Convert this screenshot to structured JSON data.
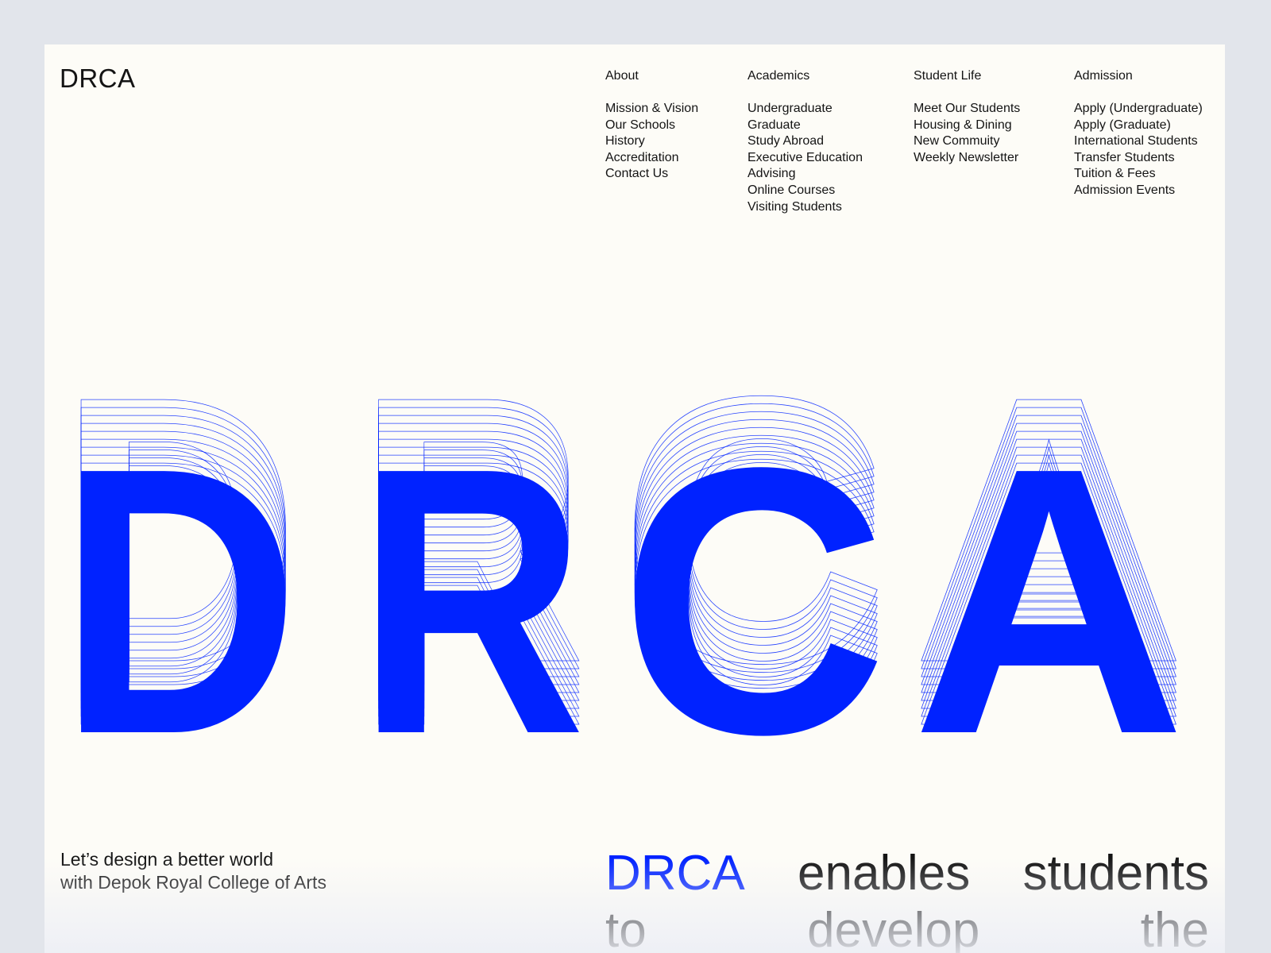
{
  "logo": "DRCA",
  "nav": [
    {
      "heading": "About",
      "items": [
        "Mission & Vision",
        "Our Schools",
        "History",
        "Accreditation",
        "Contact Us"
      ]
    },
    {
      "heading": "Academics",
      "items": [
        "Undergraduate",
        "Graduate",
        "Study Abroad",
        "Executive Education",
        "Advising",
        "Online Courses",
        "Visiting Students"
      ]
    },
    {
      "heading": "Student Life",
      "items": [
        "Meet Our Students",
        "Housing & Dining",
        "New Commuity",
        "Weekly Newsletter"
      ]
    },
    {
      "heading": "Admission",
      "items": [
        "Apply (Undergraduate)",
        "Apply (Graduate)",
        "International Students",
        "Transfer Students",
        "Tuition & Fees",
        "Admission Events"
      ]
    }
  ],
  "hero": {
    "letters": [
      "D",
      "R",
      "C",
      "A"
    ],
    "accent_color": "#0022ff"
  },
  "tagline": {
    "line1": "Let’s design a better world",
    "line2": "with Depok Royal College of Arts"
  },
  "statement": {
    "line1": [
      "DRCA",
      "enables",
      "students"
    ],
    "line2": [
      "to",
      "develop",
      "the"
    ]
  }
}
